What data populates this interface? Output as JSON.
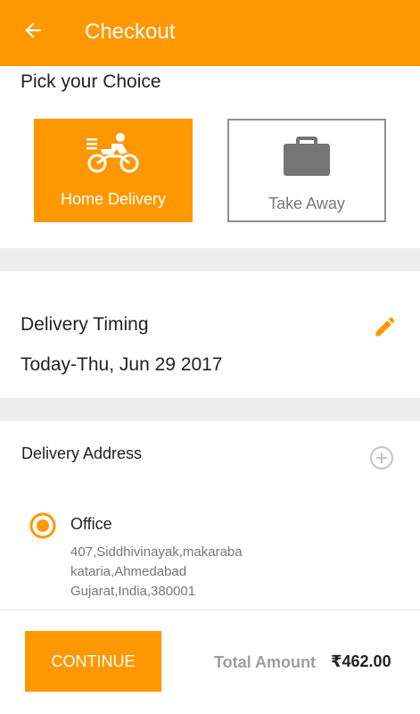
{
  "header": {
    "title": "Checkout",
    "back_icon": "arrow-left-icon",
    "background": "#ff9800"
  },
  "choice": {
    "title": "Pick your Choice",
    "options": [
      {
        "label": "Home Delivery",
        "icon": "bicycle-delivery-icon",
        "selected": true
      },
      {
        "label": "Take Away",
        "icon": "briefcase-icon",
        "selected": false
      }
    ]
  },
  "delivery_timing": {
    "title": "Delivery Timing",
    "value": "Today-Thu, Jun 29 2017",
    "edit_icon": "pencil-icon"
  },
  "delivery_address": {
    "title": "Delivery Address",
    "add_icon": "plus-circle-icon",
    "addresses": [
      {
        "name": "Office",
        "lines": [
          "407,Siddhivinayak,makaraba",
          "kataria,Ahmedabad",
          "Gujarat,India,380001"
        ],
        "selected": true
      }
    ]
  },
  "footer": {
    "continue_label": "CONTINUE",
    "total_label": "Total Amount",
    "total_value": "₹462.00"
  },
  "colors": {
    "accent": "#ff9800",
    "muted_text": "#777777",
    "divider": "#eeeeee"
  }
}
